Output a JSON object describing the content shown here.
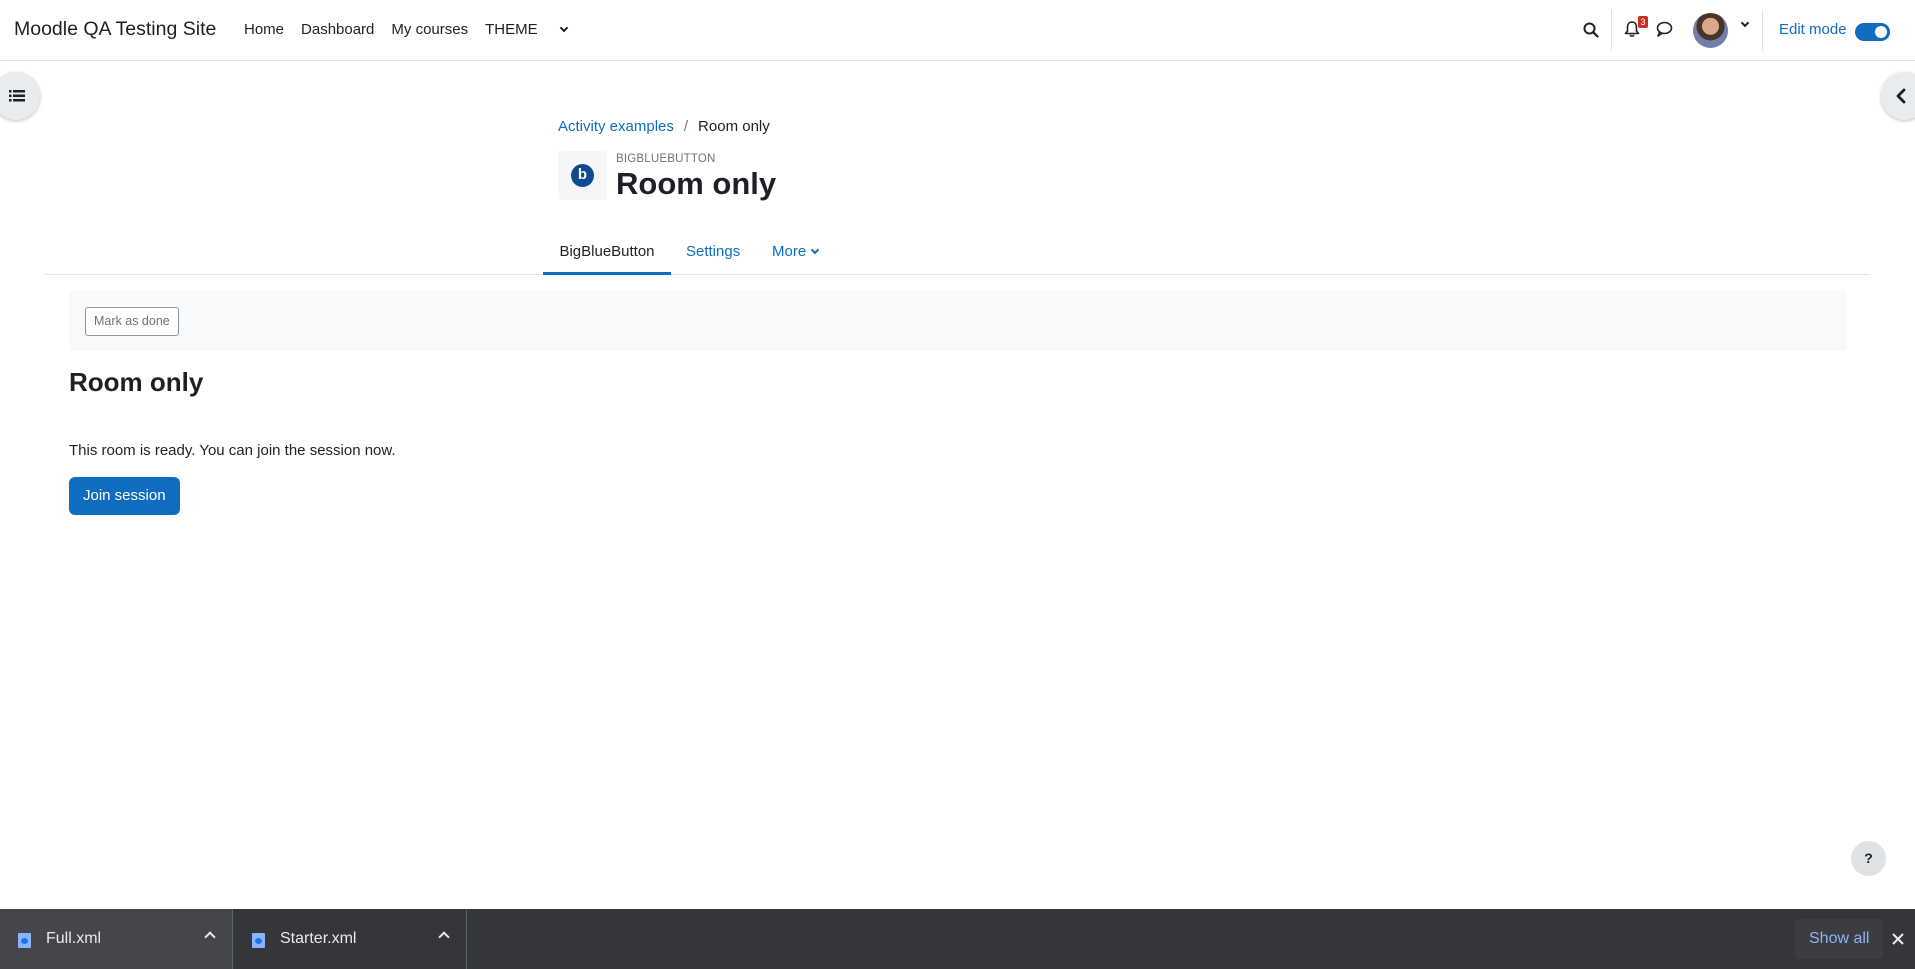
{
  "navbar": {
    "brand": "Moodle QA Testing Site",
    "links": [
      "Home",
      "Dashboard",
      "My courses"
    ],
    "theme_label": "THEME",
    "notification_count": "3",
    "edit_mode_label": "Edit mode",
    "edit_mode_on": true
  },
  "breadcrumb": {
    "parent": "Activity examples",
    "separator": "/",
    "current": "Room only"
  },
  "header": {
    "activity_type": "BIGBLUEBUTTON",
    "title": "Room only",
    "icon_glyph": "b"
  },
  "secondary_nav": {
    "tabs": [
      "BigBlueButton",
      "Settings",
      "More"
    ],
    "active": "BigBlueButton"
  },
  "completion": {
    "mark_done_label": "Mark as done"
  },
  "content": {
    "title": "Room only",
    "status": "This room is ready. You can join the session now.",
    "join_label": "Join session"
  },
  "help": {
    "label": "?"
  },
  "downloads": {
    "items": [
      "Full.xml",
      "Starter.xml"
    ],
    "show_all_label": "Show all"
  },
  "colors": {
    "accent": "#0f6cbf",
    "bbb_icon": "#0d4a91",
    "badge": "#ca3120",
    "downloads_bar": "#35363a"
  }
}
